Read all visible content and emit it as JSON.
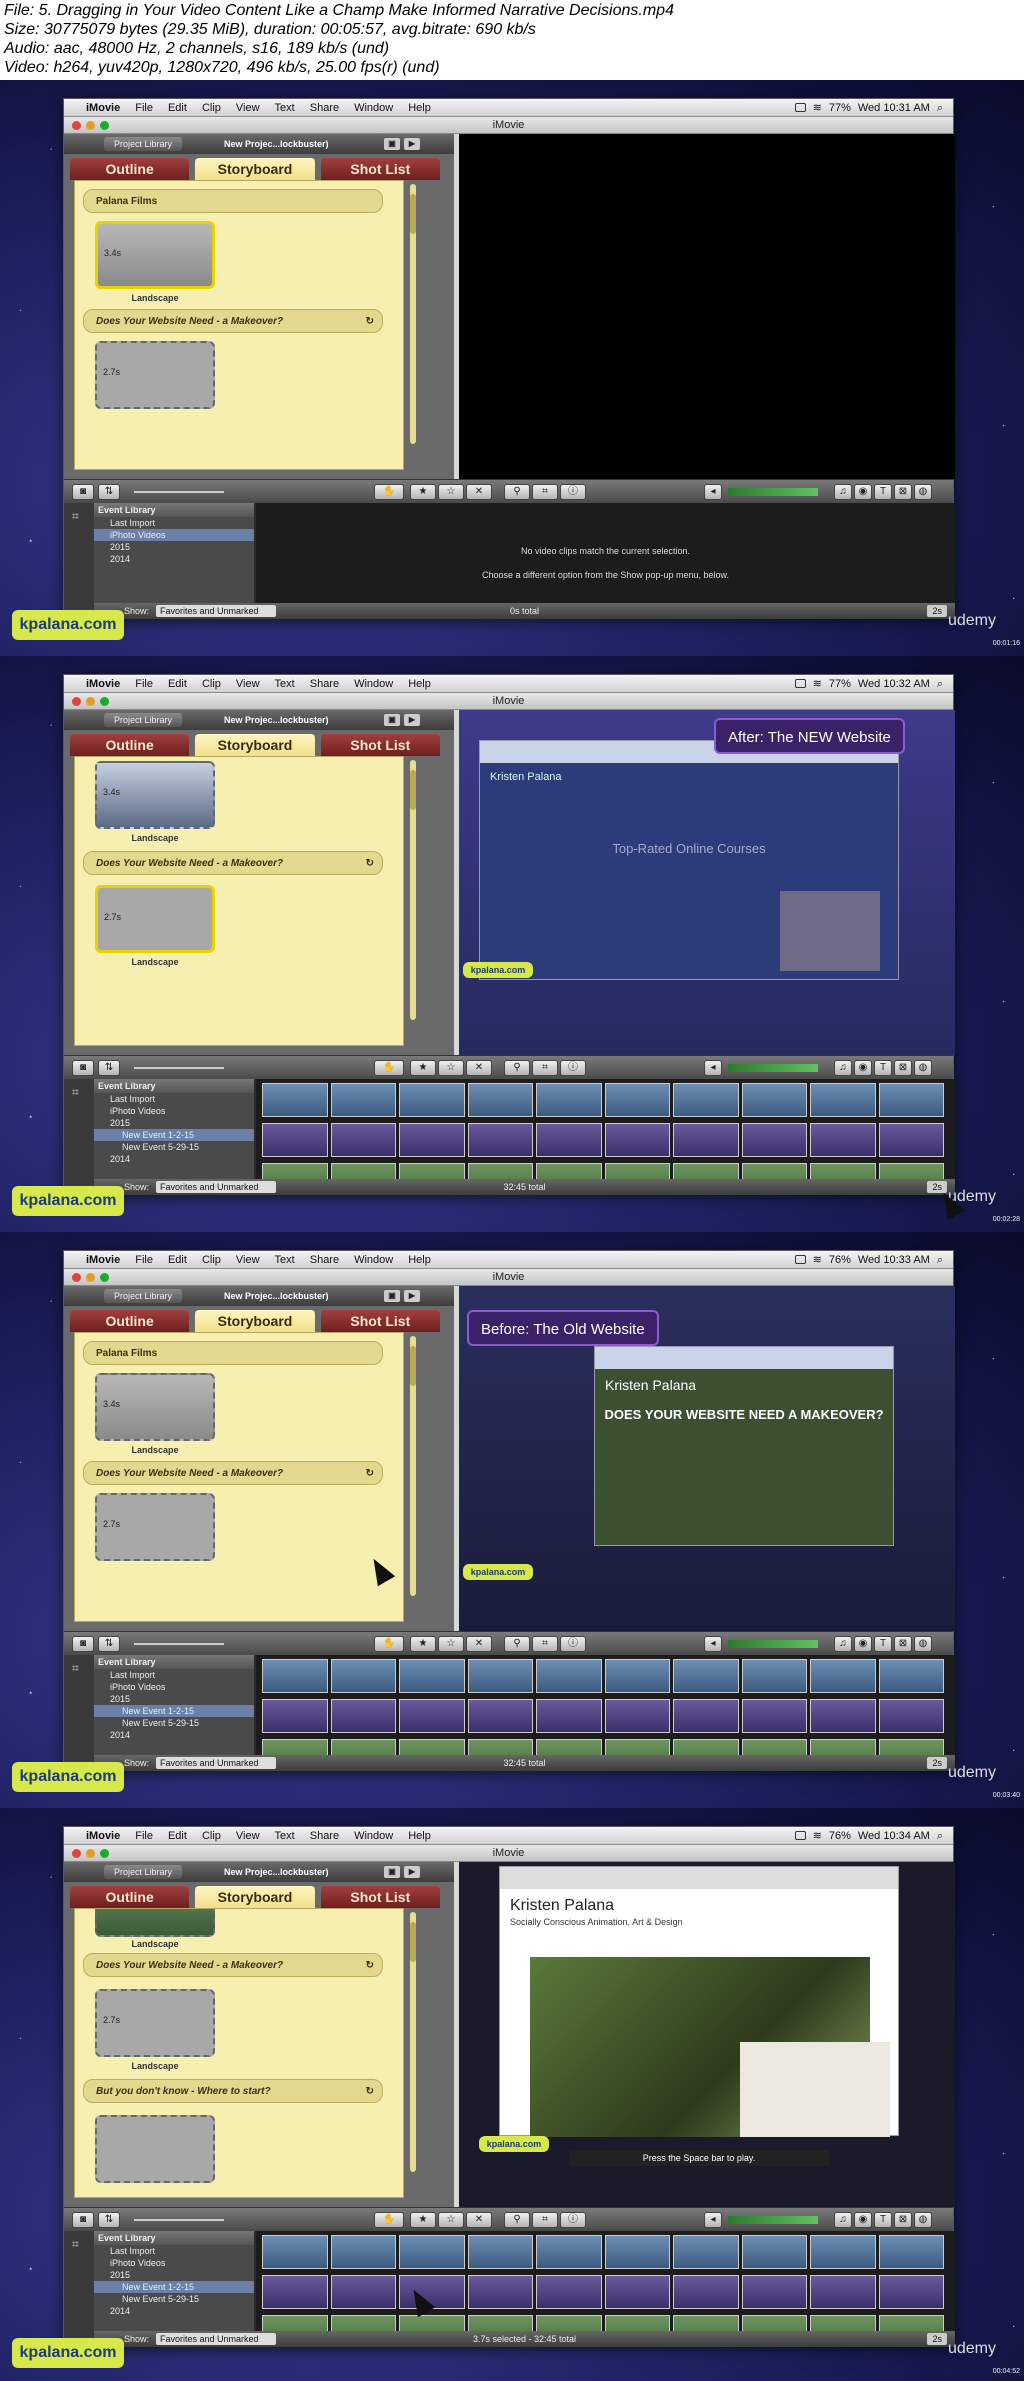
{
  "header": {
    "line1": "File: 5. Dragging in Your Video Content Like a Champ Make Informed Narrative Decisions.mp4",
    "line2": "Size: 30775079 bytes (29.35 MiB), duration: 00:05:57, avg.bitrate: 690 kb/s",
    "line3": "Audio: aac, 48000 Hz, 2 channels, s16, 189 kb/s (und)",
    "line4": "Video: h264, yuv420p, 1280x720, 496 kb/s, 25.00 fps(r) (und)"
  },
  "menu": {
    "app": "iMovie",
    "items": [
      "File",
      "Edit",
      "Clip",
      "View",
      "Text",
      "Share",
      "Window",
      "Help"
    ],
    "window_title": "iMovie",
    "project_library": "Project Library",
    "project_name": "New Projec...lockbuster)"
  },
  "tabs": {
    "outline": "Outline",
    "storyboard": "Storyboard",
    "shotlist": "Shot List"
  },
  "event_library": {
    "header": "Event Library",
    "last_import": "Last Import",
    "iphoto": "iPhoto Videos",
    "y2015": "2015",
    "y2014": "2014",
    "ev1": "New Event 1-2-15",
    "ev2": "New Event 5-29-15"
  },
  "bottom": {
    "show": "Show:",
    "filter": "Favorites and Unmarked",
    "zoom": "2s"
  },
  "branding": {
    "logo": "kpalana.com",
    "udemy": "udemy"
  },
  "frames": [
    {
      "clock": "Wed 10:31 AM",
      "battery": "77%",
      "timestamp": "00:01:16",
      "cap1": "Palana Films",
      "cap2": "Does Your Website Need - a Makeover?",
      "thumb1": "3.4s",
      "thumb2": "2.7s",
      "label": "Landscape",
      "msg1": "No video clips match the current selection.",
      "msg2": "Choose a different option from the Show pop-up menu, below.",
      "total": "0s total"
    },
    {
      "clock": "Wed 10:32 AM",
      "battery": "77%",
      "timestamp": "00:02:28",
      "overlay": "After: The NEW Website",
      "cap2": "Does Your Website Need - a Makeover?",
      "thumb1": "3.4s",
      "thumb2": "2.7s",
      "label": "Landscape",
      "site_head": "Kristen Palana",
      "site_title": "Top-Rated Online Courses",
      "total": "32:45 total"
    },
    {
      "clock": "Wed 10:33 AM",
      "battery": "76%",
      "timestamp": "00:03:40",
      "overlay": "Before: The Old Website",
      "cap1": "Palana Films",
      "cap2": "Does Your Website Need - a Makeover?",
      "thumb1": "3.4s",
      "thumb2": "2.7s",
      "label": "Landscape",
      "site_head": "Kristen Palana",
      "site_title": "DOES YOUR WEBSITE NEED A MAKEOVER?",
      "total": "32:45 total"
    },
    {
      "clock": "Wed 10:34 AM",
      "battery": "76%",
      "timestamp": "00:04:52",
      "cap2": "Does Your Website Need - a Makeover?",
      "cap3": "But you don't know - Where to start?",
      "thumb2": "2.7s",
      "label": "Landscape",
      "site_head": "Kristen Palana",
      "site_sub": "Socially Conscious Animation, Art & Design",
      "hint": "Press the Space bar to play.",
      "total": "3.7s selected - 32:45 total"
    }
  ]
}
